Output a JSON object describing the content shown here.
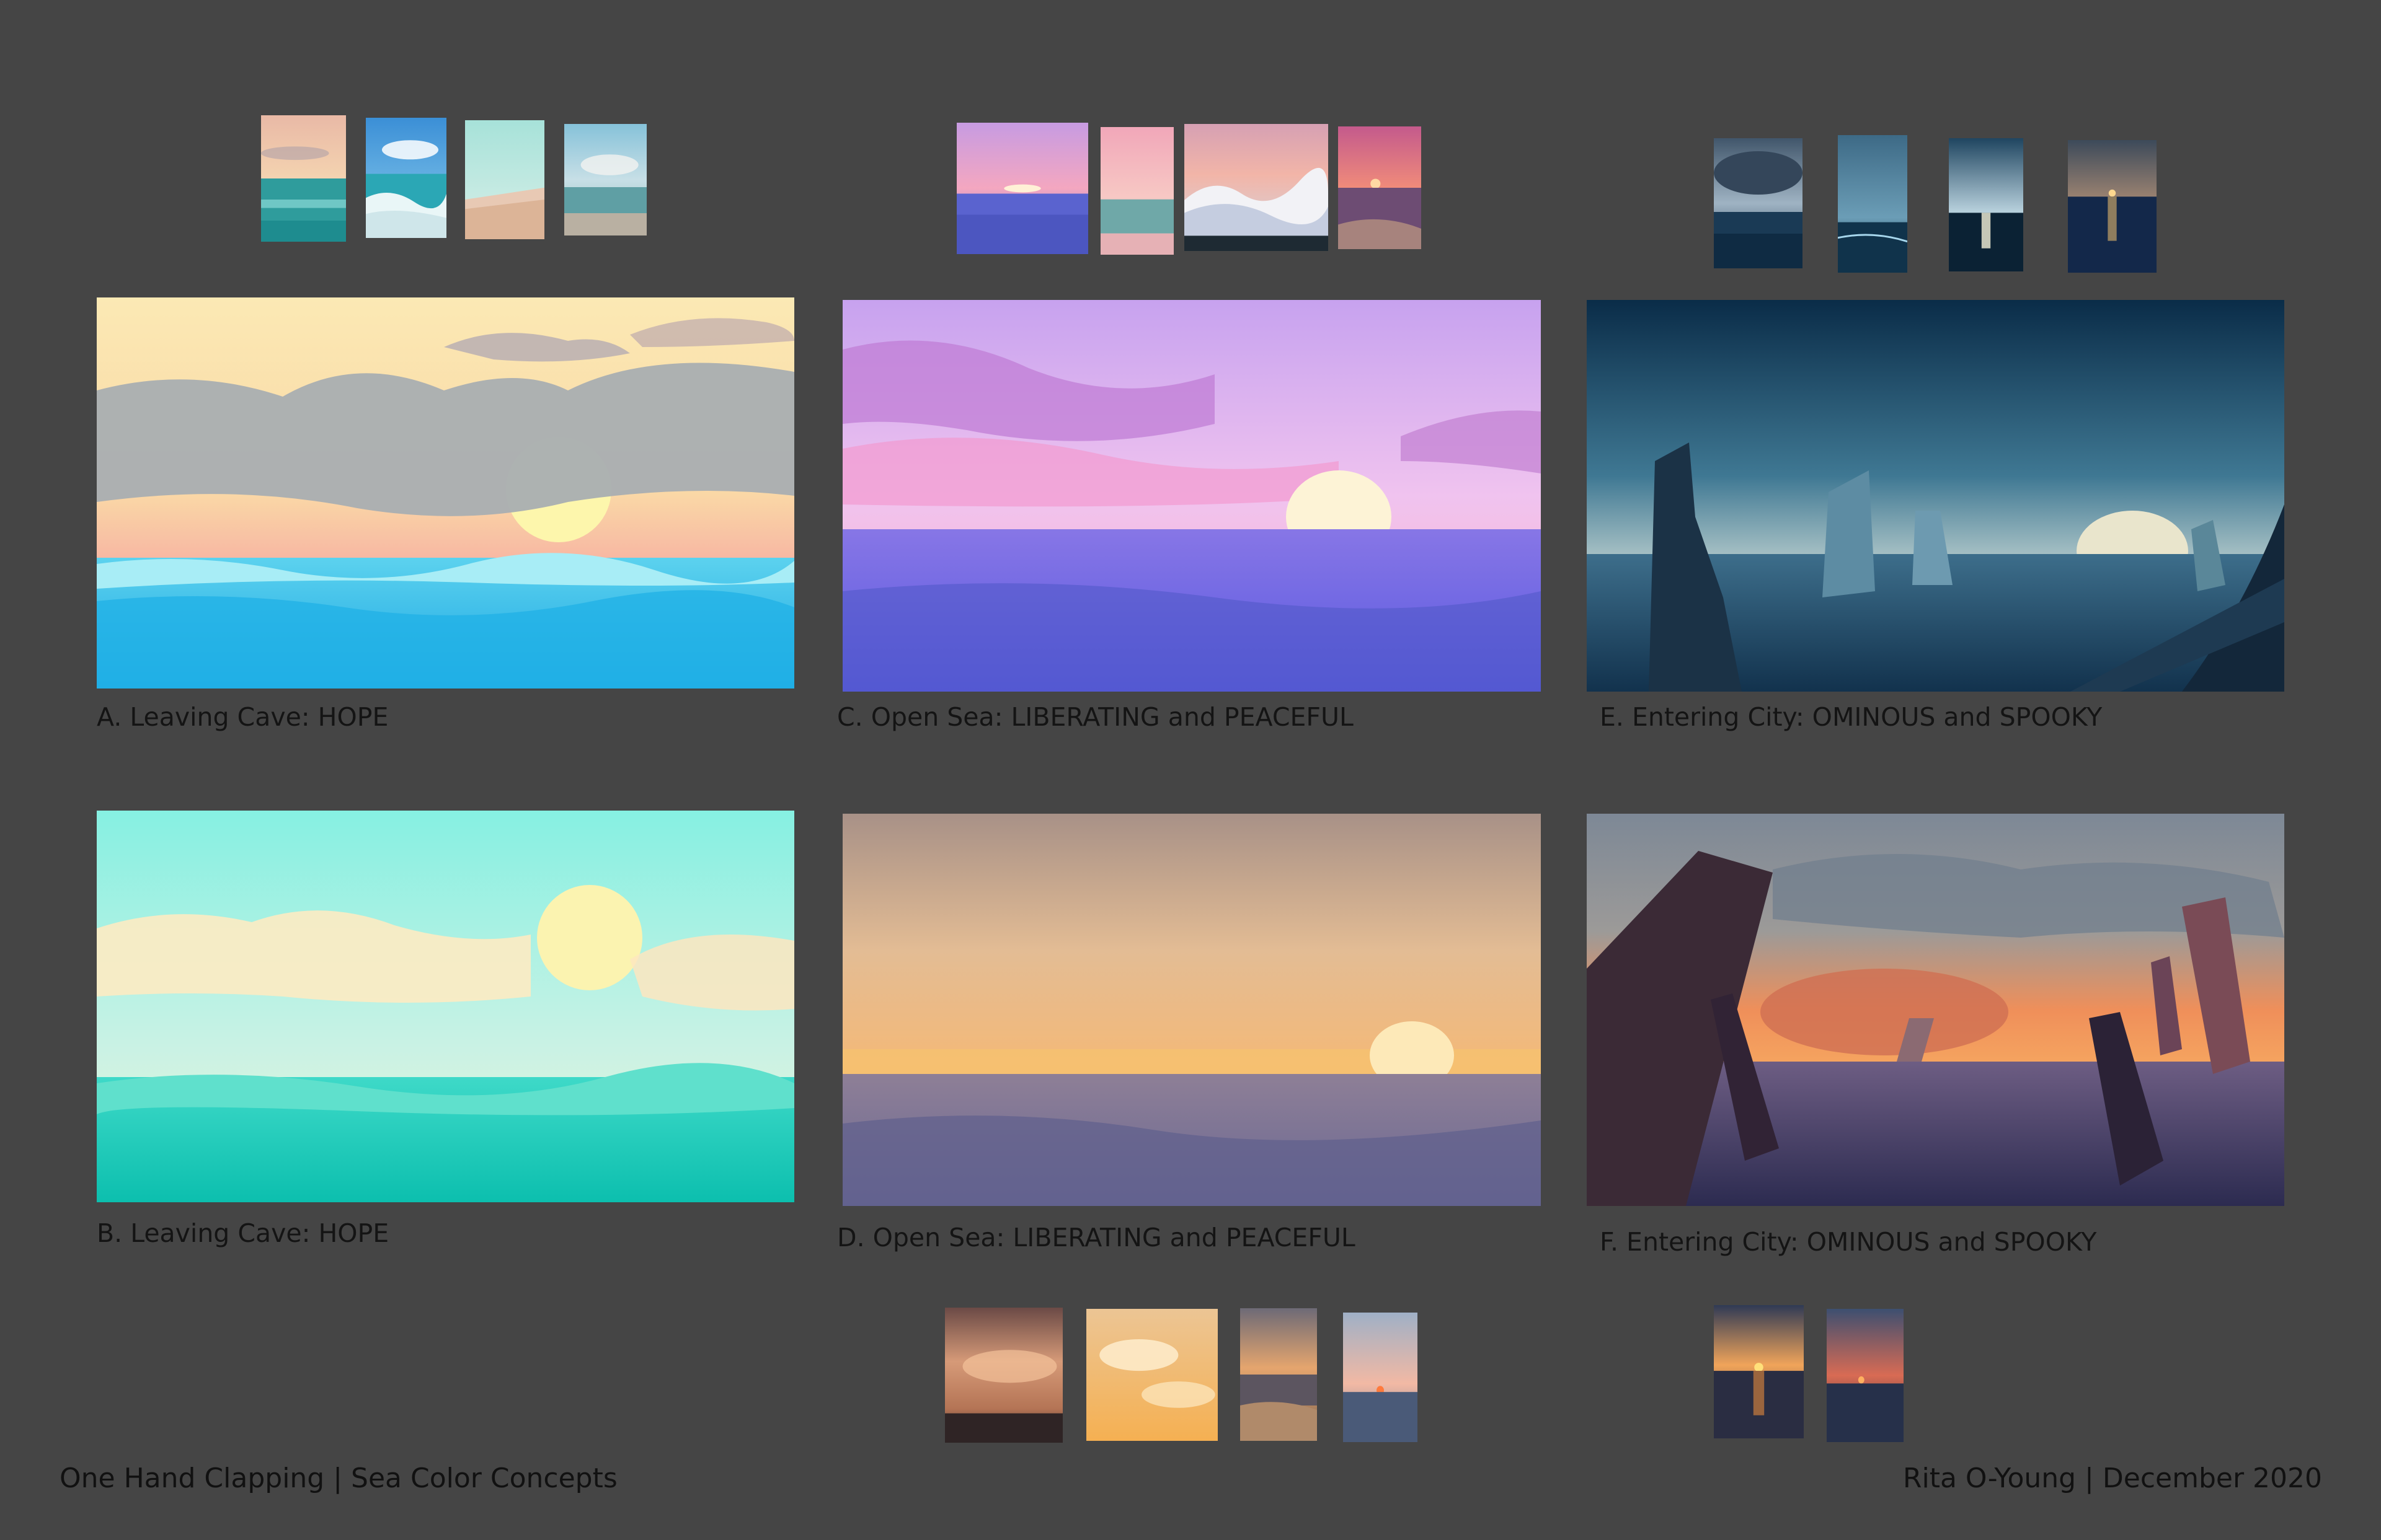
{
  "captions": {
    "a": "A. Leaving Cave: HOPE",
    "b": "B. Leaving Cave: HOPE",
    "c": "C. Open Sea: LIBERATING and PEACEFUL",
    "d": "D. Open Sea: LIBERATING and PEACEFUL",
    "e": "E. Entering City: OMINOUS and SPOOKY",
    "f": "F. Entering City: OMINOUS and SPOOKY"
  },
  "footer": {
    "left": "One Hand Clapping | Sea Color Concepts",
    "right": "Rita O-Young | December 2020"
  },
  "panels": [
    {
      "id": "a",
      "subject": "pastel sunset over turquoise sea with grey clouds"
    },
    {
      "id": "b",
      "subject": "mint sky, pale sun, teal sea"
    },
    {
      "id": "c",
      "subject": "violet-pink sky, sun on horizon, blue-violet sea"
    },
    {
      "id": "d",
      "subject": "golden dusk haze, sun on horizon, muted violet sea"
    },
    {
      "id": "e",
      "subject": "dark teal sea with monolith rocks and setting sun"
    },
    {
      "id": "f",
      "subject": "orange sunset behind dark leaning monoliths"
    }
  ],
  "colors": {
    "background": "#454545",
    "text": "#141414"
  }
}
